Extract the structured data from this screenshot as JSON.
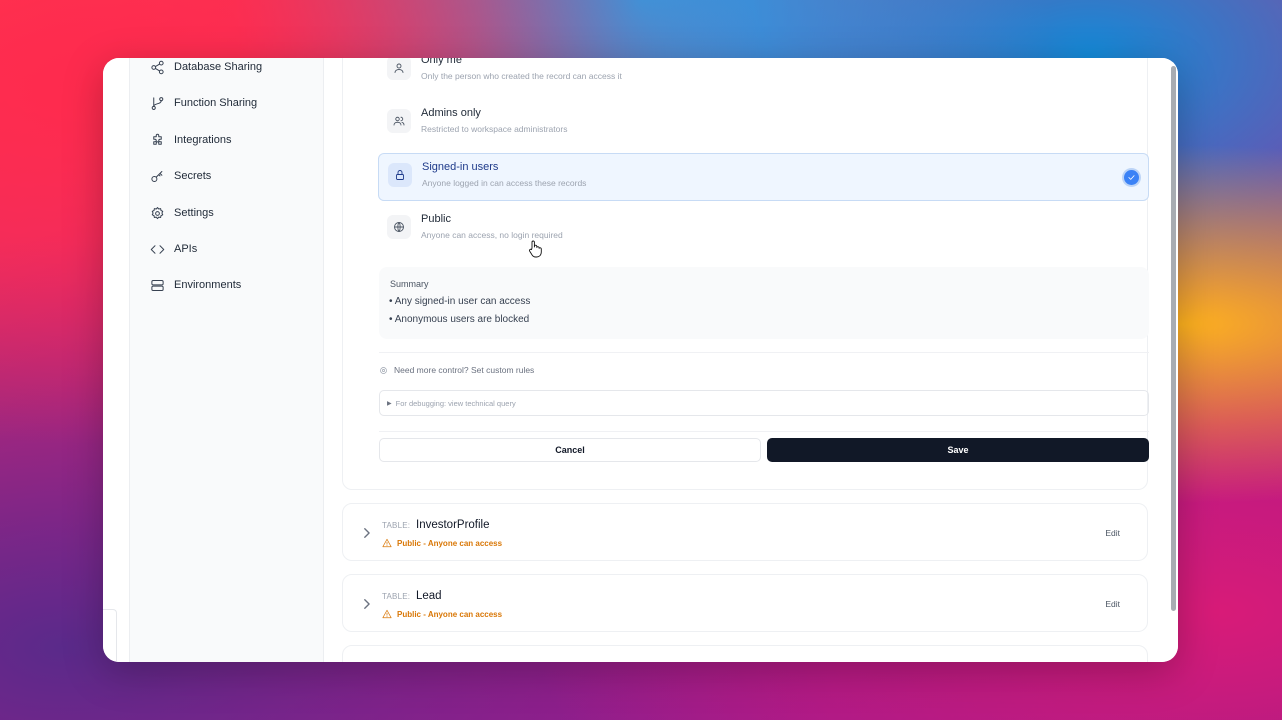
{
  "sidebar": {
    "items": [
      {
        "label": "Database Sharing",
        "icon": "share-icon"
      },
      {
        "label": "Function Sharing",
        "icon": "git-branch-icon"
      },
      {
        "label": "Integrations",
        "icon": "puzzle-icon"
      },
      {
        "label": "Secrets",
        "icon": "key-icon"
      },
      {
        "label": "Settings",
        "icon": "gear-icon"
      },
      {
        "label": "APIs",
        "icon": "code-icon"
      },
      {
        "label": "Environments",
        "icon": "server-icon"
      }
    ]
  },
  "access_options": [
    {
      "title": "Only me",
      "description": "Only the person who created the record can access it",
      "icon": "user-icon",
      "selected": false
    },
    {
      "title": "Admins only",
      "description": "Restricted to workspace administrators",
      "icon": "users-icon",
      "selected": false
    },
    {
      "title": "Signed-in users",
      "description": "Anyone logged in can access these records",
      "icon": "lock-icon",
      "selected": true
    },
    {
      "title": "Public",
      "description": "Anyone can access, no login required",
      "icon": "globe-icon",
      "selected": false
    }
  ],
  "summary": {
    "title": "Summary",
    "lines": [
      "• Any signed-in user can access",
      "• Anonymous users are blocked"
    ]
  },
  "custom_rules_link": "Need more control? Set custom rules",
  "debug_toggle": "For debugging: view technical query",
  "buttons": {
    "cancel": "Cancel",
    "save": "Save"
  },
  "tables": [
    {
      "prefix": "TABLE:",
      "name": "InvestorProfile",
      "status": "Public - Anyone can access",
      "edit": "Edit"
    },
    {
      "prefix": "TABLE:",
      "name": "Lead",
      "status": "Public - Anyone can access",
      "edit": "Edit"
    }
  ],
  "colors": {
    "accent": "#3b82f6",
    "warning": "#d97706",
    "primary_button": "#111827"
  }
}
